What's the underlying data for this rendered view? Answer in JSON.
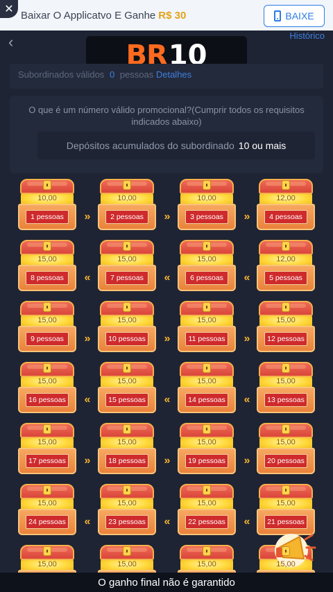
{
  "banner": {
    "text": "Baixar O Applicatvo E Ganhe",
    "amount": "R$ 30",
    "button_label": "BAIXE",
    "close_icon": "close-icon",
    "button_icon": "phone-icon"
  },
  "header": {
    "back_icon": "chevron-left-icon",
    "history_label": "Histórico"
  },
  "logo": {
    "br": "BR",
    "ten": "10"
  },
  "subordinates": {
    "label": "Subordinados válidos",
    "count": "0",
    "unit": "pessoas",
    "details_label": "Detalhes"
  },
  "info": {
    "question": "O que é um número válido promocional?(Cumprir todos os requisitos indicados abaixo)",
    "deposit_label": "Depósitos acumulados do subordinado",
    "deposit_value": "10 ou mais"
  },
  "chests": [
    {
      "value": "10,00",
      "label": "1 pessoas"
    },
    {
      "value": "10,00",
      "label": "2 pessoas"
    },
    {
      "value": "10,00",
      "label": "3 pessoas"
    },
    {
      "value": "12,00",
      "label": "4 pessoas"
    },
    {
      "value": "15,00",
      "label": "8 pessoas"
    },
    {
      "value": "15,00",
      "label": "7 pessoas"
    },
    {
      "value": "15,00",
      "label": "6 pessoas"
    },
    {
      "value": "12,00",
      "label": "5 pessoas"
    },
    {
      "value": "15,00",
      "label": "9 pessoas"
    },
    {
      "value": "15,00",
      "label": "10 pessoas"
    },
    {
      "value": "15,00",
      "label": "11 pessoas"
    },
    {
      "value": "15,00",
      "label": "12 pessoas"
    },
    {
      "value": "15,00",
      "label": "16 pessoas"
    },
    {
      "value": "15,00",
      "label": "15 pessoas"
    },
    {
      "value": "15,00",
      "label": "14 pessoas"
    },
    {
      "value": "15,00",
      "label": "13 pessoas"
    },
    {
      "value": "15,00",
      "label": "17 pessoas"
    },
    {
      "value": "15,00",
      "label": "18 pessoas"
    },
    {
      "value": "15,00",
      "label": "19 pessoas"
    },
    {
      "value": "15,00",
      "label": "20 pessoas"
    },
    {
      "value": "15,00",
      "label": "24 pessoas"
    },
    {
      "value": "15,00",
      "label": "23 pessoas"
    },
    {
      "value": "15,00",
      "label": "22 pessoas"
    },
    {
      "value": "15,00",
      "label": "21 pessoas"
    },
    {
      "value": "15,00",
      "label": ""
    },
    {
      "value": "15,00",
      "label": ""
    },
    {
      "value": "15,00",
      "label": ""
    },
    {
      "value": "15,00",
      "label": ""
    }
  ],
  "row_directions": [
    "right",
    "left",
    "right",
    "left",
    "right",
    "left",
    "right"
  ],
  "caption": "O ganho final não é garantido",
  "colors": {
    "accent": "#3f7fe0",
    "gold": "#f3b22d",
    "plate": "#cf2a2c",
    "background": "#1e2434"
  }
}
